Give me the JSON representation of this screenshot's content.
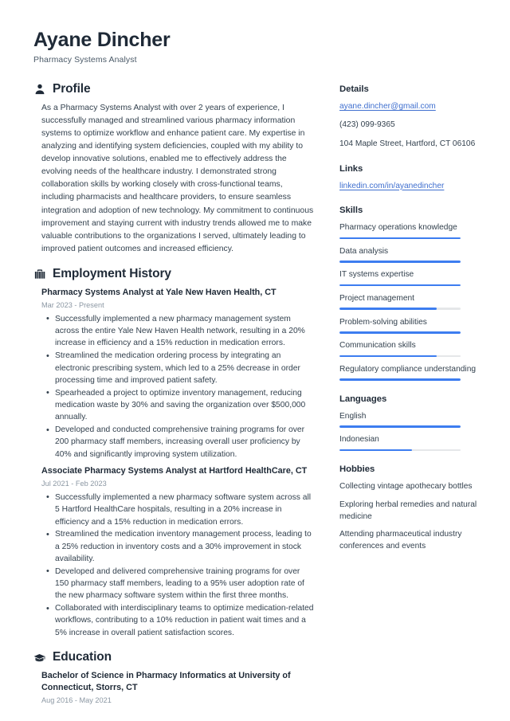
{
  "header": {
    "full_name": "Ayane Dincher",
    "job_title": "Pharmacy Systems Analyst"
  },
  "theme": {
    "accent_blue": "#3d7df0",
    "link_blue": "#3f6fcf",
    "heading_dark": "#1f2a37",
    "body_text": "#33414e",
    "muted_date": "#8b97a3",
    "bar_track": "#e5e7e9"
  },
  "main": {
    "profile": {
      "icon": "person-icon",
      "title": "Profile",
      "text": "As a Pharmacy Systems Analyst with over 2 years of experience, I successfully managed and streamlined various pharmacy information systems to optimize workflow and enhance patient care. My expertise in analyzing and identifying system deficiencies, coupled with my ability to develop innovative solutions, enabled me to effectively address the evolving needs of the healthcare industry. I demonstrated strong collaboration skills by working closely with cross-functional teams, including pharmacists and healthcare providers, to ensure seamless integration and adoption of new technology. My commitment to continuous improvement and staying current with industry trends allowed me to make valuable contributions to the organizations I served, ultimately leading to improved patient outcomes and increased efficiency."
    },
    "employment": {
      "icon": "briefcase-icon",
      "title": "Employment History",
      "entries": [
        {
          "title": "Pharmacy Systems Analyst at Yale New Haven Health, CT",
          "date": "Mar 2023 - Present",
          "bullets": [
            "Successfully implemented a new pharmacy management system across the entire Yale New Haven Health network, resulting in a 20% increase in efficiency and a 15% reduction in medication errors.",
            "Streamlined the medication ordering process by integrating an electronic prescribing system, which led to a 25% decrease in order processing time and improved patient safety.",
            "Spearheaded a project to optimize inventory management, reducing medication waste by 30% and saving the organization over $500,000 annually.",
            "Developed and conducted comprehensive training programs for over 200 pharmacy staff members, increasing overall user proficiency by 40% and significantly improving system utilization."
          ]
        },
        {
          "title": "Associate Pharmacy Systems Analyst at Hartford HealthCare, CT",
          "date": "Jul 2021 - Feb 2023",
          "bullets": [
            "Successfully implemented a new pharmacy software system across all 5 Hartford HealthCare hospitals, resulting in a 20% increase in efficiency and a 15% reduction in medication errors.",
            "Streamlined the medication inventory management process, leading to a 25% reduction in inventory costs and a 30% improvement in stock availability.",
            "Developed and delivered comprehensive training programs for over 150 pharmacy staff members, leading to a 95% user adoption rate of the new pharmacy software system within the first three months.",
            "Collaborated with interdisciplinary teams to optimize medication-related workflows, contributing to a 10% reduction in patient wait times and a 5% increase in overall patient satisfaction scores."
          ]
        }
      ]
    },
    "education": {
      "icon": "graduation-cap-icon",
      "title": "Education",
      "entries": [
        {
          "title": "Bachelor of Science in Pharmacy Informatics at University of Connecticut, Storrs, CT",
          "date": "Aug 2016 - May 2021"
        }
      ]
    }
  },
  "sidebar": {
    "details": {
      "title": "Details",
      "email": "ayane.dincher@gmail.com",
      "phone": "(423) 099-9365",
      "address": "104 Maple Street, Hartford, CT 06106"
    },
    "links": {
      "title": "Links",
      "items": [
        {
          "label": "linkedin.com/in/ayanedincher"
        }
      ]
    },
    "skills": {
      "title": "Skills",
      "items": [
        {
          "label": "Pharmacy operations knowledge",
          "level": 100
        },
        {
          "label": "Data analysis",
          "level": 100
        },
        {
          "label": "IT systems expertise",
          "level": 100
        },
        {
          "label": "Project management",
          "level": 80
        },
        {
          "label": "Problem-solving abilities",
          "level": 100
        },
        {
          "label": "Communication skills",
          "level": 80
        },
        {
          "label": "Regulatory compliance understanding",
          "level": 100
        }
      ]
    },
    "languages": {
      "title": "Languages",
      "items": [
        {
          "label": "English",
          "level": 100
        },
        {
          "label": "Indonesian",
          "level": 60
        }
      ]
    },
    "hobbies": {
      "title": "Hobbies",
      "items": [
        {
          "label": "Collecting vintage apothecary bottles"
        },
        {
          "label": "Exploring herbal remedies and natural medicine"
        },
        {
          "label": "Attending pharmaceutical industry conferences and events"
        }
      ]
    }
  }
}
